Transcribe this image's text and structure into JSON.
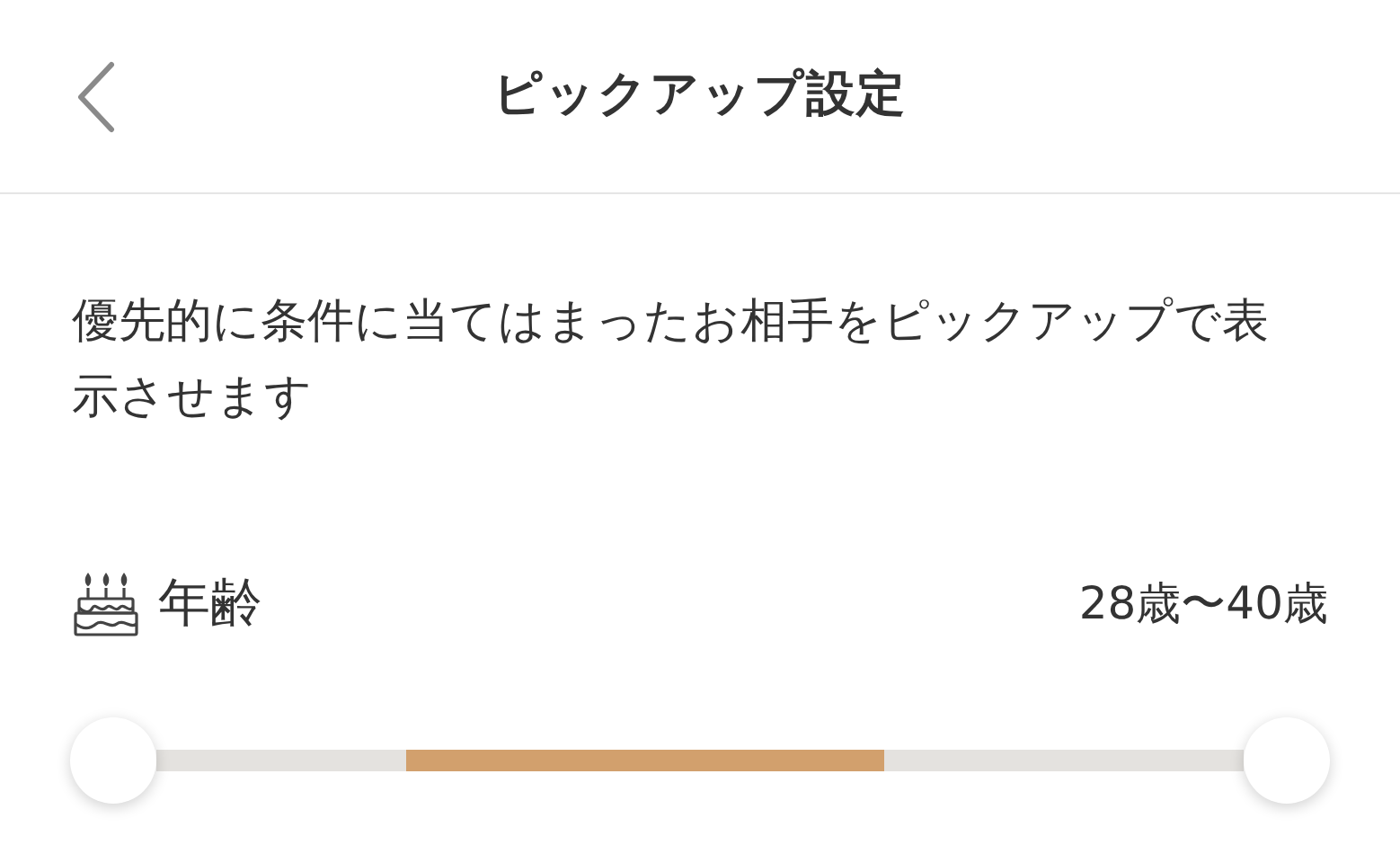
{
  "header": {
    "title": "ピックアップ設定"
  },
  "description": "優先的に条件に当てはまったお相手をピックアップで表示させます",
  "age": {
    "label": "年齢",
    "value": "28歳〜40歳",
    "slider": {
      "low_thumb": {
        "level": 0
      },
      "high_thumb": {
        "level": 1
      }
    }
  }
}
